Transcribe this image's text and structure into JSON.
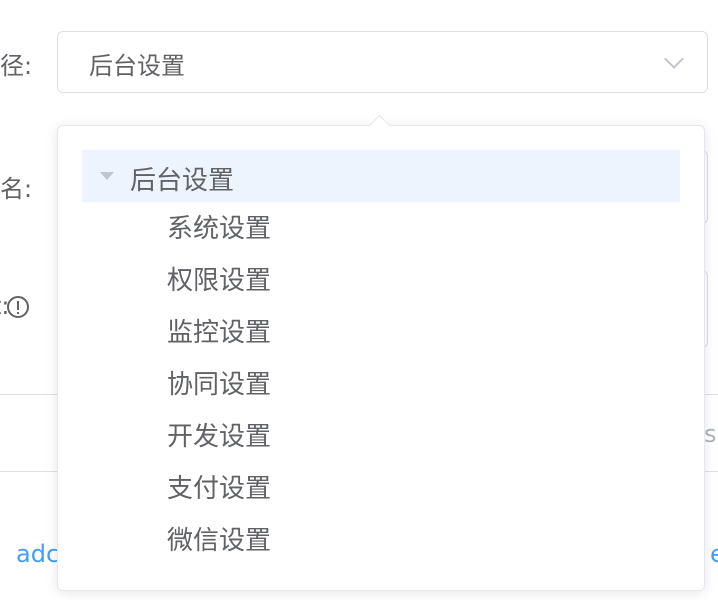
{
  "form": {
    "path_label": "径:",
    "name_label": "名:",
    "third_label": "t:"
  },
  "select": {
    "value": "后台设置"
  },
  "background": {
    "left_link": "adc",
    "right_link": "e",
    "right_grey": "s"
  },
  "tree": {
    "root_label": "后台设置",
    "children": [
      {
        "label": "系统设置"
      },
      {
        "label": "权限设置"
      },
      {
        "label": "监控设置"
      },
      {
        "label": "协同设置"
      },
      {
        "label": "开发设置"
      },
      {
        "label": "支付设置"
      },
      {
        "label": "微信设置"
      }
    ]
  }
}
